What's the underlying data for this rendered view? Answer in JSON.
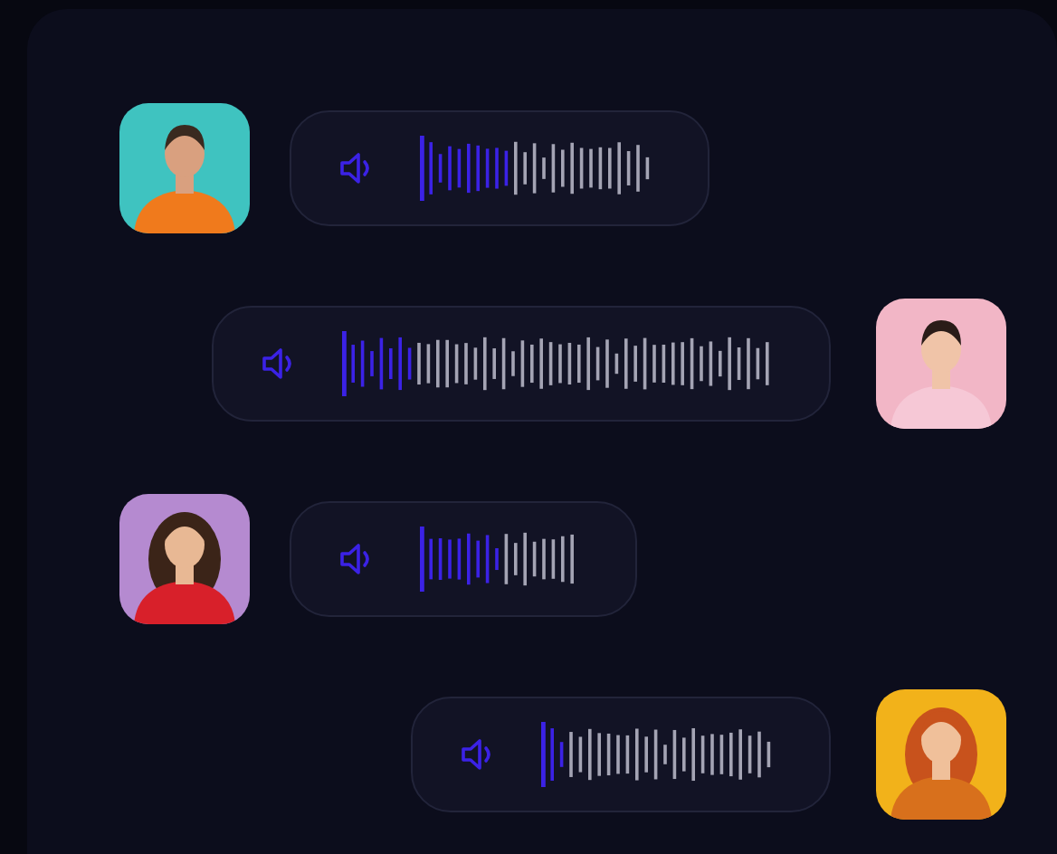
{
  "messages": [
    {
      "outgoing": false,
      "level": 0.38
    },
    {
      "outgoing": true,
      "level": 0.17
    },
    {
      "outgoing": false,
      "level": 0.5
    },
    {
      "outgoing": true,
      "level": 0.1
    }
  ]
}
